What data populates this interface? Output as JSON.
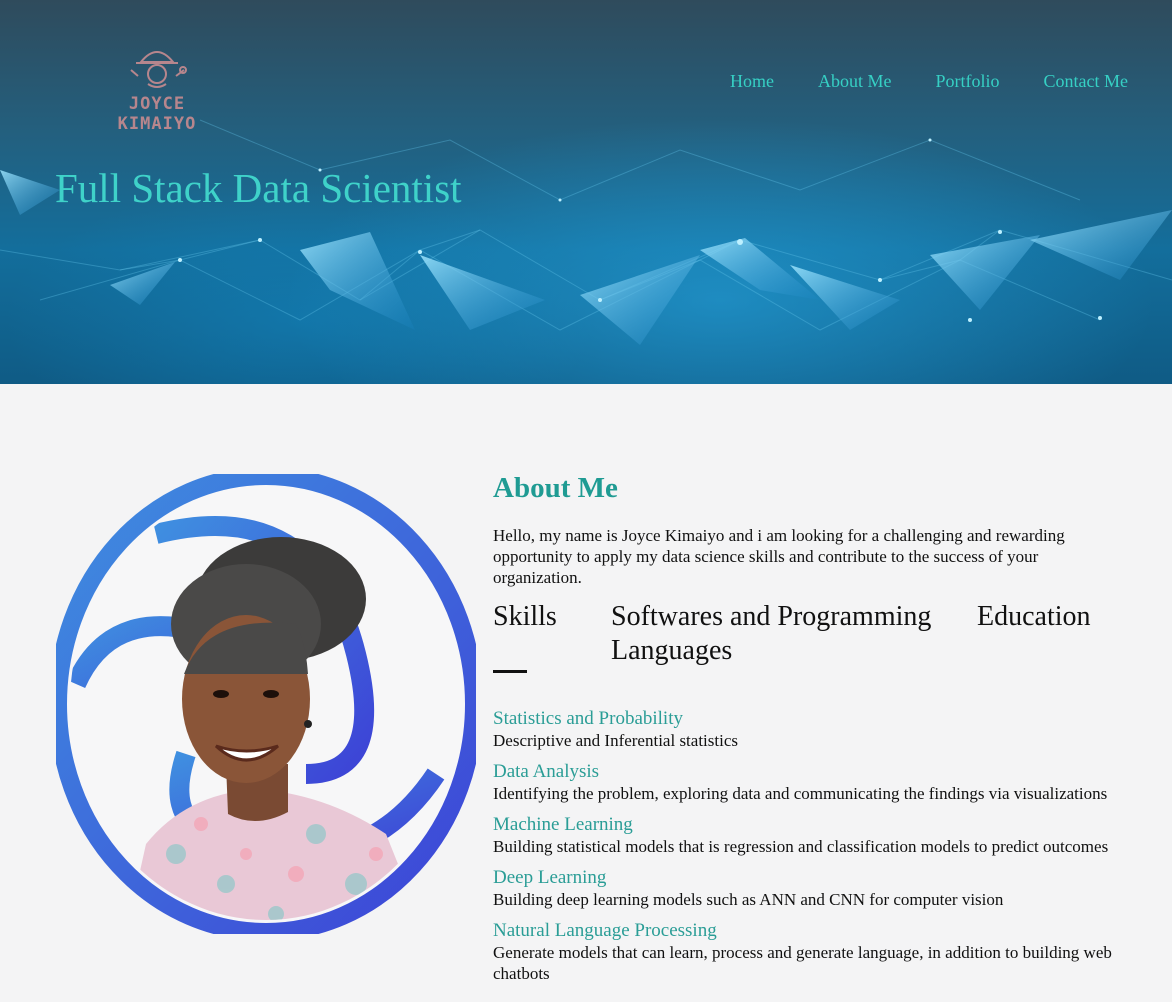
{
  "header": {
    "logo_text": "JOYCE KIMAIYO",
    "nav": [
      "Home",
      "About Me",
      "Portfolio",
      "Contact Me"
    ],
    "hero_title": "Full Stack Data Scientist"
  },
  "about": {
    "heading": "About Me",
    "intro": "Hello, my name is Joyce Kimaiyo and i am looking for a challenging and rewarding opportunity to apply my data science skills and contribute to the success of your organization.",
    "tabs": [
      "Skills",
      "Softwares and Programming Languages",
      "Education"
    ],
    "active_tab": "Skills",
    "skills": [
      {
        "name": "Statistics and Probability",
        "desc": "Descriptive and Inferential statistics"
      },
      {
        "name": "Data Analysis",
        "desc": "Identifying the problem, exploring data and communicating the findings via visualizations"
      },
      {
        "name": "Machine Learning",
        "desc": "Building statistical models that is regression and classification models to predict outcomes"
      },
      {
        "name": "Deep Learning",
        "desc": "Building deep learning models such as ANN and CNN for computer vision"
      },
      {
        "name": "Natural Language Processing",
        "desc": "Generate models that can learn, process and generate language, in addition to building web chatbots"
      }
    ]
  },
  "icons": {
    "logo": "hardhat-gear-icon",
    "profile_photo": "profile-photo"
  },
  "colors": {
    "accent": "#36d0c4",
    "heading_teal": "#1f9b93",
    "skill_teal": "#2a9d96",
    "logo_pink": "#b7868d",
    "ring_blue": "#3f6fe0"
  }
}
